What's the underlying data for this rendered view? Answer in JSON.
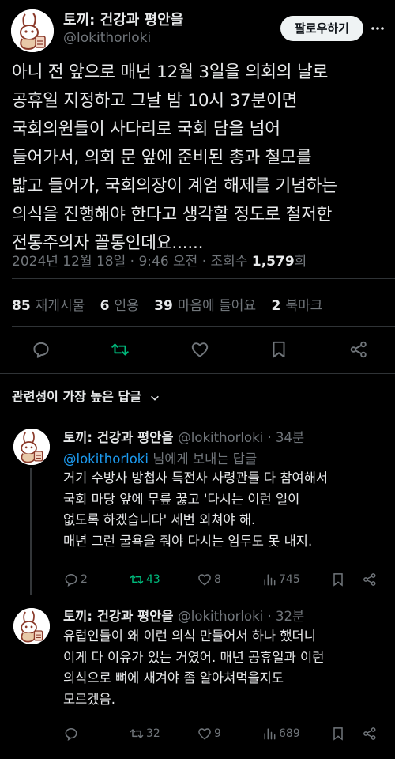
{
  "tweet": {
    "author_name": "토끼: 건강과 평안을",
    "author_handle": "@lokithorloki",
    "follow_label": "팔로우하기",
    "lines": [
      "아니 전 앞으로 매년 12월 3일을 의회의 날로",
      "공휴일 지정하고 그날 밤 10시 37분이면",
      "국회의원들이 사다리로 국회 담을 넘어",
      "들어가서, 의회 문 앞에 준비된 총과 철모를",
      "밟고 들어가, 국회의장이 계엄 해제를 기념하는",
      "의식을 진행해야 한다고 생각할 정도로 철저한",
      "전통주의자 꼴통인데요......"
    ],
    "timestamp": "2024년 12월 18일 · 9:46 오전 · 조회수 ",
    "views": "1,579",
    "views_suffix": "회",
    "stats": {
      "reposts_count": "85",
      "reposts_label": "재게시물",
      "quotes_count": "6",
      "quotes_label": "인용",
      "likes_count": "39",
      "likes_label": "마음에 들어요",
      "bookmarks_count": "2",
      "bookmarks_label": "북마크"
    }
  },
  "sort_label": "관련성이 가장 높은 답글",
  "replies": [
    {
      "name": "토끼: 건강과 평안을",
      "handle_time": "@lokithorloki · 34분",
      "reply_to_mention": "@lokithorloki",
      "reply_to_suffix": " 님에게 보내는 답글",
      "lines": [
        "거기 수방사 방첩사 특전사 사령관들 다 참여해서",
        "국회 마당 앞에 무릎 꿇고 '다시는 이런 일이",
        "없도록 하겠습니다' 세번 외쳐야 해.",
        "매년 그런 굴욕을 줘야 다시는 엄두도 못 내지."
      ],
      "replies": "2",
      "reposts": "43",
      "likes": "8",
      "views": "745"
    },
    {
      "name": "토끼: 건강과 평안을",
      "handle_time": "@lokithorloki · 32분",
      "lines": [
        "유럽인들이 왜 이런 의식 만들어서 하나 했더니",
        "이게 다 이유가 있는 거였어. 매년 공휴일과 이런",
        "의식으로 뼈에 새겨야 좀 알아쳐먹을지도",
        "모르겠음."
      ],
      "replies": "",
      "reposts": "32",
      "likes": "9",
      "views": "689"
    }
  ],
  "colors": {
    "background": "#000000",
    "text": "#e7e9ea",
    "muted": "#71767b",
    "accent": "#1d9bf0",
    "repost_active": "#00ba7c"
  }
}
